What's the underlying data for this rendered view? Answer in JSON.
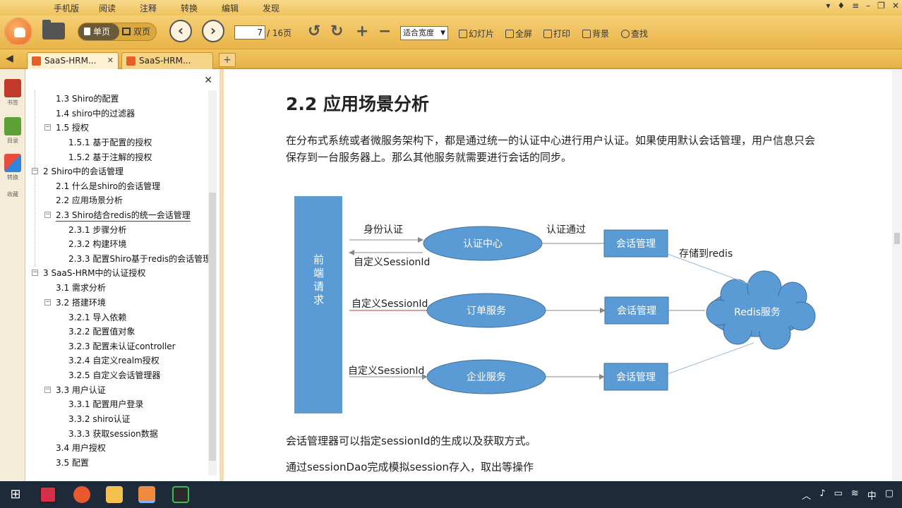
{
  "menu": [
    "手机版",
    "阅读",
    "注释",
    "转换",
    "编辑",
    "发现"
  ],
  "toolbar": {
    "single_label": "单页",
    "double_label": "双页",
    "page_current": "7",
    "page_total": "/ 16页",
    "zoom_value": "适合宽度",
    "slideshow": "幻灯片",
    "fullscreen": "全屏",
    "print": "打印",
    "background": "背景",
    "find": "查找"
  },
  "tabs": [
    {
      "label": "SaaS-HRM..."
    },
    {
      "label": "SaaS-HRM..."
    }
  ],
  "leftstrip": [
    "书签",
    "目录",
    "转换",
    "收藏"
  ],
  "toc": [
    {
      "label": "1.3 Shiro的配置"
    },
    {
      "label": "1.4 shiro中的过滤器"
    },
    {
      "label": "1.5 授权"
    },
    {
      "label": "1.5.1 基于配置的授权"
    },
    {
      "label": "1.5.2 基于注解的授权"
    },
    {
      "label": "2 Shiro中的会话管理"
    },
    {
      "label": "2.1 什么是shiro的会话管理"
    },
    {
      "label": "2.2 应用场景分析"
    },
    {
      "label": "2.3 Shiro结合redis的统一会话管理"
    },
    {
      "label": "2.3.1 步骤分析"
    },
    {
      "label": "2.3.2 构建环境"
    },
    {
      "label": "2.3.3 配置Shiro基于redis的会话管理"
    },
    {
      "label": "3 SaaS-HRM中的认证授权"
    },
    {
      "label": "3.1 需求分析"
    },
    {
      "label": "3.2 搭建环境"
    },
    {
      "label": "3.2.1 导入依赖"
    },
    {
      "label": "3.2.2 配置值对象"
    },
    {
      "label": "3.2.3 配置未认证controller"
    },
    {
      "label": "3.2.4 自定义realm授权"
    },
    {
      "label": "3.2.5 自定义会话管理器"
    },
    {
      "label": "3.3 用户认证"
    },
    {
      "label": "3.3.1 配置用户登录"
    },
    {
      "label": "3.3.2 shiro认证"
    },
    {
      "label": "3.3.3 获取session数据"
    },
    {
      "label": "3.4 用户授权"
    },
    {
      "label": "3.5 配置"
    }
  ],
  "doc": {
    "title": "2.2 应用场景分析",
    "para1_line1": "在分布式系统或者微服务架构下，都是通过统一的认证中心进行用户认证。如果使用默认会话管理，用户信息只会",
    "para1_line2": "保存到一台服务器上。那么其他服务就需要进行会话的同步。",
    "para2": "会话管理器可以指定sessionId的生成以及获取方式。",
    "para3": "通过sessionDao完成模拟session存入，取出等操作"
  },
  "diagram": {
    "front": "前端请求",
    "auth_center": "认证中心",
    "order_service": "订单服务",
    "company_service": "企业服务",
    "session_mgr": "会话管理",
    "redis": "Redis服务",
    "identity_auth": "身份认证",
    "auth_passed": "认证通过",
    "custom_session": "自定义SessionId",
    "store_redis": "存储到redis"
  },
  "colors": {
    "box": "#5b9bd5",
    "box_border": "#41719c",
    "toolbar": "#f0c35b"
  }
}
